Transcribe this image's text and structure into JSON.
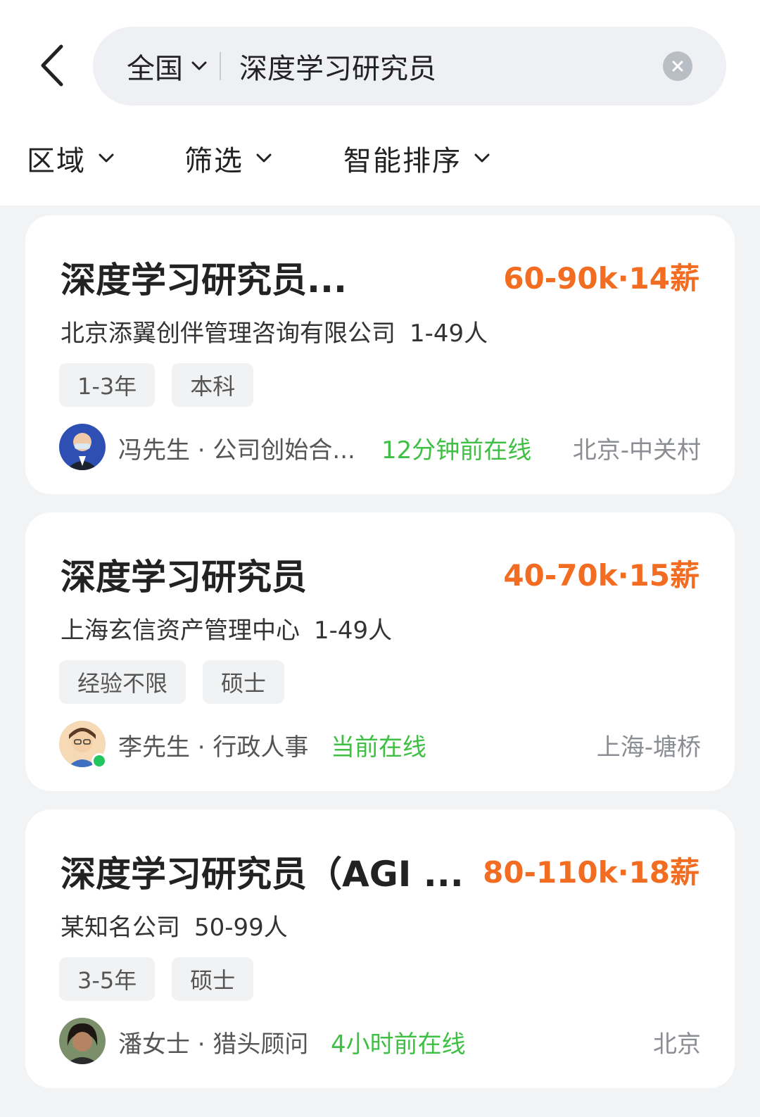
{
  "header": {
    "region": "全国",
    "search_value": "深度学习研究员",
    "search_placeholder": ""
  },
  "filters": [
    {
      "label": "区域"
    },
    {
      "label": "筛选"
    },
    {
      "label": "智能排序"
    }
  ],
  "jobs": [
    {
      "title": "深度学习研究员...",
      "salary": "60-90k·14薪",
      "company": "北京添翼创伴管理咨询有限公司",
      "size": "1-49人",
      "tags": [
        "1-3年",
        "本科"
      ],
      "recruiter": "冯先生 · 公司创始合...",
      "online": "12分钟前在线",
      "location": "北京-中关村"
    },
    {
      "title": "深度学习研究员",
      "salary": "40-70k·15薪",
      "company": "上海玄信资产管理中心",
      "size": "1-49人",
      "tags": [
        "经验不限",
        "硕士"
      ],
      "recruiter": "李先生 · 行政人事",
      "online": "当前在线",
      "location": "上海-塘桥"
    },
    {
      "title": "深度学习研究员（AGI ...",
      "salary": "80-110k·18薪",
      "company": "某知名公司",
      "size": "50-99人",
      "tags": [
        "3-5年",
        "硕士"
      ],
      "recruiter": "潘女士 · 猎头顾问",
      "online": "4小时前在线",
      "location": "北京"
    }
  ],
  "colors": {
    "salary": "#f26d21",
    "online": "#3fbf43",
    "background": "#f2f3f5"
  },
  "icons": [
    "back-arrow-icon",
    "chevron-down-icon",
    "clear-icon"
  ]
}
